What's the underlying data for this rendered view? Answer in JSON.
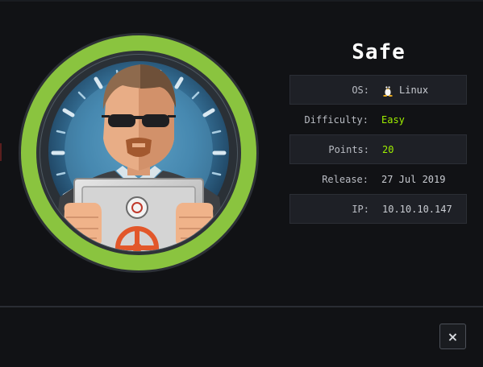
{
  "machine": {
    "name": "Safe",
    "avatar_icon": "safe-machine-avatar",
    "ring_color": "#8ac43f"
  },
  "info": {
    "rows": [
      {
        "label": "OS:",
        "value": "Linux",
        "icon": "linux-tux-icon",
        "shaded": true
      },
      {
        "label": "Difficulty:",
        "value": "Easy",
        "shaded": false
      },
      {
        "label": "Points:",
        "value": "20",
        "shaded": true
      },
      {
        "label": "Release:",
        "value": "27 Jul 2019",
        "shaded": false
      },
      {
        "label": "IP:",
        "value": "10.10.10.147",
        "shaded": true
      }
    ]
  },
  "colors": {
    "accent_green": "#9fef00",
    "background": "#111215"
  },
  "footer": {
    "close_label": "×"
  }
}
